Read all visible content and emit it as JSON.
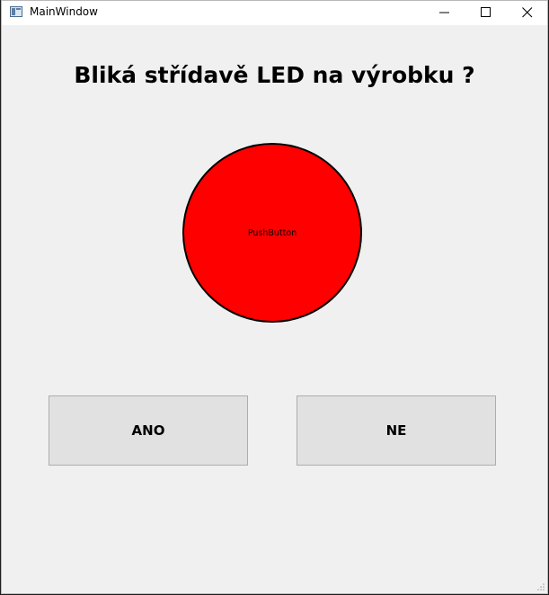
{
  "window": {
    "title": "MainWindow",
    "icons": {
      "app": "app-window-icon",
      "minimize": "minimize-icon",
      "maximize": "maximize-icon",
      "close": "close-icon"
    }
  },
  "main": {
    "heading": "Bliká střídavě LED na výrobku ?",
    "indicator": {
      "label": "PushButton",
      "color": "#ff0000"
    },
    "buttons": {
      "yes_label": "ANO",
      "no_label": "NE"
    }
  }
}
